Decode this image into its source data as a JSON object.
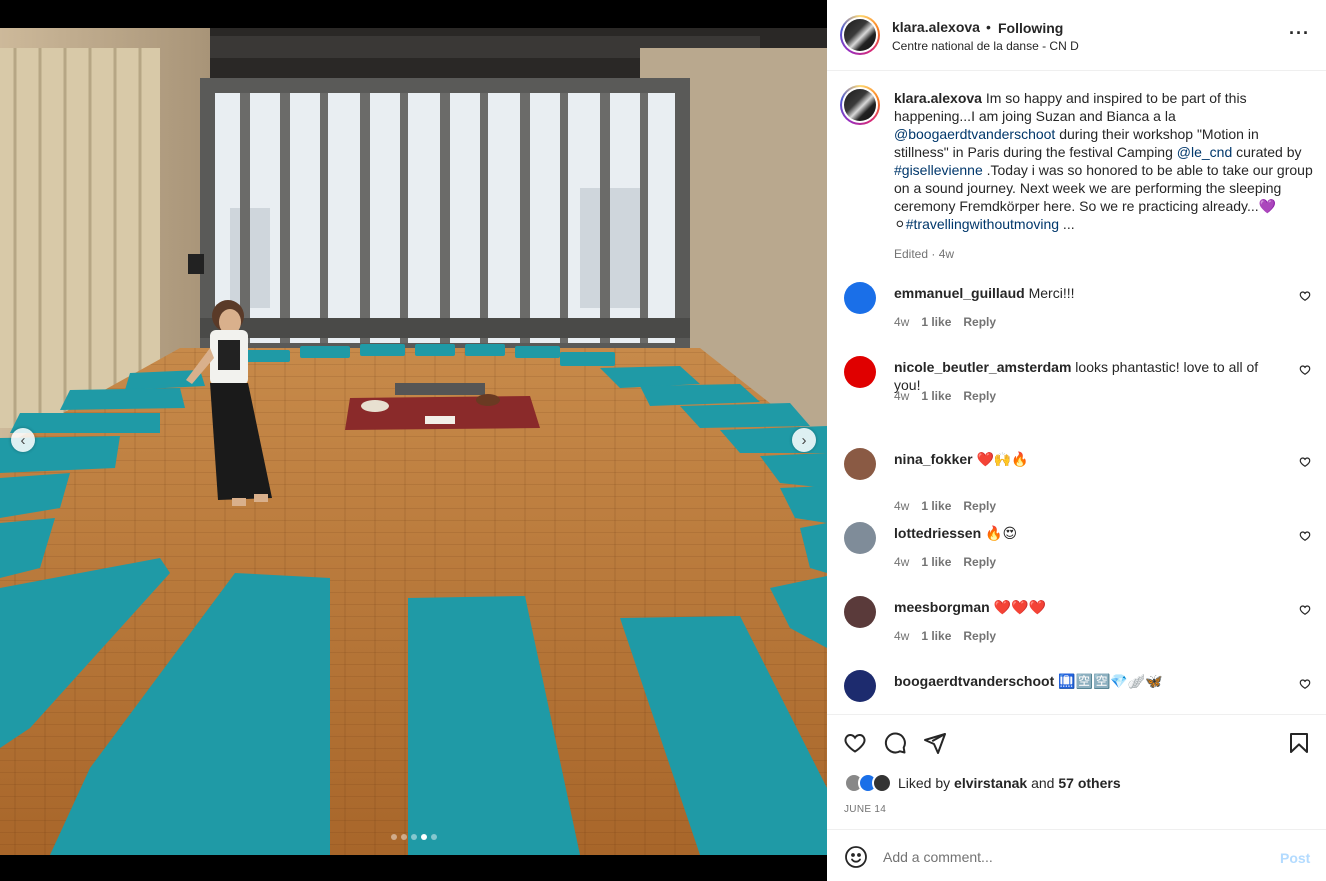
{
  "header": {
    "username": "klara.alexova",
    "separator": "•",
    "follow_status": "Following",
    "location": "Centre national de la danse - CN D",
    "more_icon": "more-horizontal-icon"
  },
  "media": {
    "prev_icon": "‹",
    "next_icon": "›",
    "carousel": {
      "count": 5,
      "active_index": 3
    }
  },
  "caption": {
    "username": "klara.alexova",
    "parts": {
      "p1": " Im so happy and inspired to be part of this happening...I am joing Suzan and Bianca a la ",
      "m1": "@boogaerdtvanderschoot",
      "p2": " during their workshop \"Motion in stillness\" in Paris during the festival Camping ",
      "m2": "@le_cnd",
      "p3": " curated by ",
      "h1": "#gisellevienne",
      "p4": " .Today i was so honored to be able to take our group on a sound journey. Next week we are performing the sleeping ceremony Fremdkörper here. So we re practicing already...💜⚪",
      "h2": "#travellingwithoutmoving",
      "p5": " ..."
    },
    "edited": "Edited",
    "meta_sep": " · ",
    "time": "4w"
  },
  "comments": [
    {
      "username": "emmanuel_guillaud",
      "text": "Merci!!!",
      "time": "4w",
      "likes": "1 like",
      "reply": "Reply",
      "avatar_color": "#1a6fe8"
    },
    {
      "username": "nicole_beutler_amsterdam",
      "text": "looks phantastic! love to all of you!",
      "time": "4w",
      "likes": "1 like",
      "reply": "Reply",
      "avatar_color": "#e00000"
    },
    {
      "username": "nina_fokker",
      "text": "❤️🙌🔥",
      "time": "4w",
      "likes": "1 like",
      "reply": "Reply",
      "avatar_color": "#8a5a44"
    },
    {
      "username": "lottedriessen",
      "text": "🔥😍",
      "time": "4w",
      "likes": "1 like",
      "reply": "Reply",
      "avatar_color": "#7f8c99"
    },
    {
      "username": "meesborgman",
      "text": "❤️❤️❤️",
      "time": "4w",
      "likes": "1 like",
      "reply": "Reply",
      "avatar_color": "#5a3a3a"
    },
    {
      "username": "boogaerdtvanderschoot",
      "text": "🛄🈳🈳💎🪽🦋",
      "time": "",
      "likes": "",
      "reply": "",
      "avatar_color": "#1d2b6e"
    }
  ],
  "actions": {
    "like_icon": "heart-icon",
    "comment_icon": "comment-icon",
    "share_icon": "send-icon",
    "save_icon": "bookmark-icon",
    "liked_by_prefix": "Liked by ",
    "liked_by_user": "elvirstanak",
    "liked_by_and": " and ",
    "liked_by_others": "57 others",
    "date": "JUNE 14"
  },
  "add_comment": {
    "placeholder": "Add a comment...",
    "post_label": "Post",
    "emoji_icon": "emoji-icon"
  },
  "colors": {
    "link": "#00376b",
    "muted": "#737373",
    "post_disabled": "#b3dbff",
    "mat": "#1f9aa6",
    "floor": "#b5732f"
  }
}
